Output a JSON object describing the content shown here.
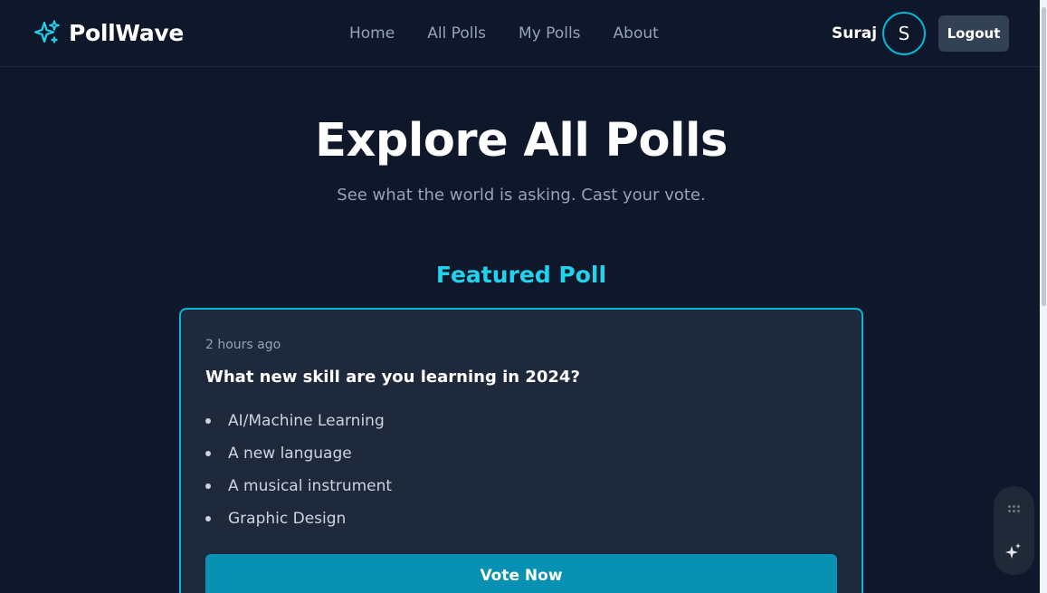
{
  "brand": {
    "name": "PollWave",
    "icon": "sparkles-icon"
  },
  "nav": {
    "links": [
      {
        "label": "Home"
      },
      {
        "label": "All Polls"
      },
      {
        "label": "My Polls"
      },
      {
        "label": "About"
      }
    ]
  },
  "user": {
    "name": "Suraj",
    "initial": "S",
    "logout_label": "Logout"
  },
  "hero": {
    "title": "Explore All Polls",
    "subtitle": "See what the world is asking. Cast your vote."
  },
  "featured": {
    "heading": "Featured Poll",
    "time": "2 hours ago",
    "question": "What new skill are you learning in 2024?",
    "options": [
      "AI/Machine Learning",
      "A new language",
      "A musical instrument",
      "Graphic Design"
    ],
    "vote_label": "Vote Now"
  },
  "widget": {
    "icons": [
      "grip-dots-icon",
      "sparkle-icon"
    ]
  },
  "colors": {
    "background": "#0f172a",
    "card": "#1e293b",
    "accent": "#22d3ee",
    "accent_border": "#06b6d4",
    "button": "#0891b2",
    "muted_text": "#94a3b8"
  }
}
